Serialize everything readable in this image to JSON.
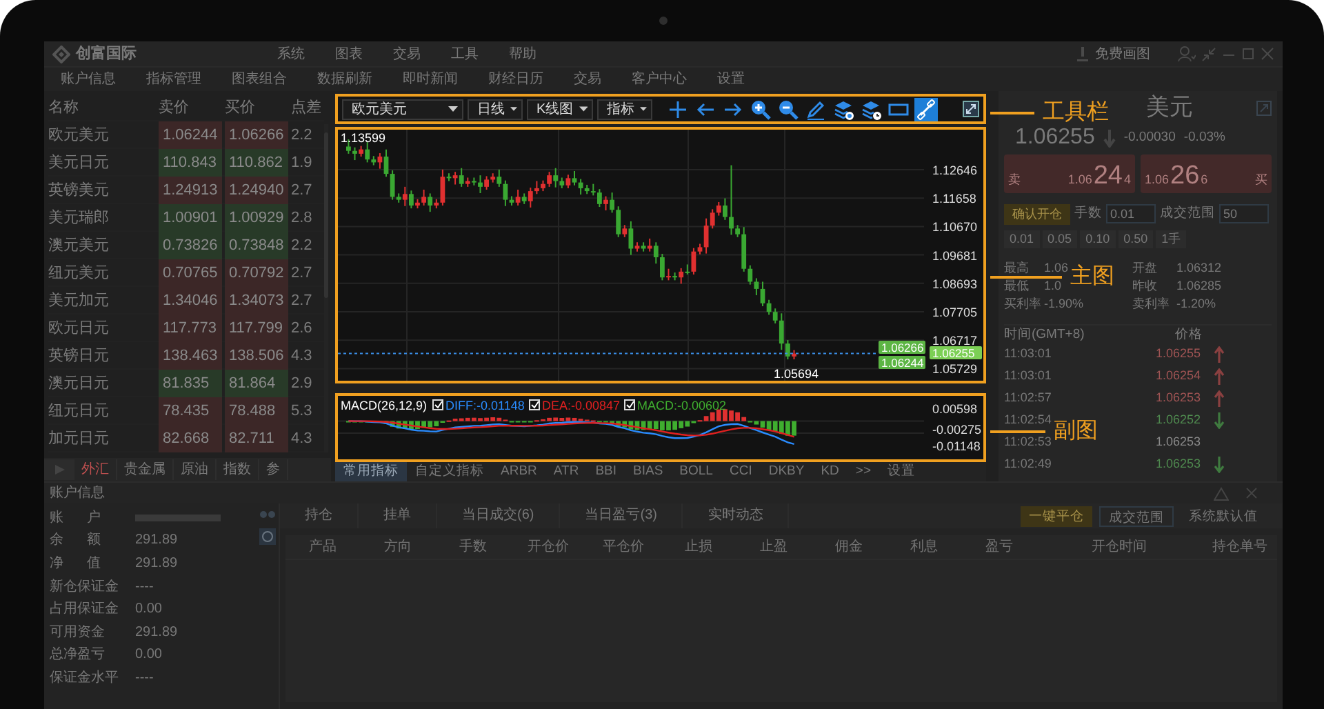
{
  "window": {
    "app_name": "创富国际",
    "menu": [
      "系统",
      "图表",
      "交易",
      "工具",
      "帮助"
    ],
    "free_drawing_link": "免费画图"
  },
  "toolbar": [
    "账户信息",
    "指标管理",
    "图表组合",
    "数据刷新",
    "即时新闻",
    "财经日历",
    "交易",
    "客户中心",
    "设置"
  ],
  "quotes": {
    "columns": [
      "名称",
      "卖价",
      "买价",
      "点差"
    ],
    "rows": [
      {
        "name": "欧元美元",
        "sell": "1.06244",
        "buy": "1.06266",
        "spread": "2.2",
        "color": "#3c2727"
      },
      {
        "name": "美元日元",
        "sell": "110.843",
        "buy": "110.862",
        "spread": "1.9",
        "color": "#283a28"
      },
      {
        "name": "英镑美元",
        "sell": "1.24913",
        "buy": "1.24940",
        "spread": "2.7",
        "color": "#3c2727"
      },
      {
        "name": "美元瑞郎",
        "sell": "1.00901",
        "buy": "1.00929",
        "spread": "2.8",
        "color": "#283a28"
      },
      {
        "name": "澳元美元",
        "sell": "0.73826",
        "buy": "0.73848",
        "spread": "2.2",
        "color": "#283a28"
      },
      {
        "name": "纽元美元",
        "sell": "0.70765",
        "buy": "0.70792",
        "spread": "2.7",
        "color": "#3c2727"
      },
      {
        "name": "美元加元",
        "sell": "1.34046",
        "buy": "1.34073",
        "spread": "2.7",
        "color": "#3c2727"
      },
      {
        "name": "欧元日元",
        "sell": "117.773",
        "buy": "117.799",
        "spread": "2.6",
        "color": "#3c2727"
      },
      {
        "name": "英镑日元",
        "sell": "138.463",
        "buy": "138.506",
        "spread": "4.3",
        "color": "#3c2727"
      },
      {
        "name": "澳元日元",
        "sell": "81.835",
        "buy": "81.864",
        "spread": "2.9",
        "color": "#283a28"
      },
      {
        "name": "纽元日元",
        "sell": "78.435",
        "buy": "78.488",
        "spread": "5.3",
        "color": "#3c2727"
      },
      {
        "name": "加元日元",
        "sell": "82.668",
        "buy": "82.711",
        "spread": "4.3",
        "color": "#3c2727"
      }
    ]
  },
  "market_tabs": [
    {
      "label": "外汇",
      "selected": true
    },
    {
      "label": "贵金属",
      "selected": false
    },
    {
      "label": "原油",
      "selected": false
    },
    {
      "label": "指数",
      "selected": false
    },
    {
      "label": "参",
      "selected": false
    }
  ],
  "chart_toolbar": {
    "selects": [
      "欧元美元",
      "日线",
      "K线图",
      "指标"
    ],
    "tools": [
      {
        "kind": "crosshair",
        "selected": false
      },
      {
        "kind": "arrow-left",
        "selected": false
      },
      {
        "kind": "arrow-right",
        "selected": false
      },
      {
        "kind": "zoom-in",
        "selected": false
      },
      {
        "kind": "zoom-out",
        "selected": false
      },
      {
        "kind": "pencil",
        "selected": false
      },
      {
        "kind": "stack-dollar",
        "selected": false
      },
      {
        "kind": "stack-clock",
        "selected": false
      },
      {
        "kind": "rectangle",
        "selected": false
      },
      {
        "kind": "link",
        "selected": true
      }
    ]
  },
  "main_chart": {
    "high_label": "1.13599",
    "low_label": "1.05694",
    "y_labels": [
      "1.12646",
      "1.11658",
      "1.10670",
      "1.09681",
      "1.08693",
      "1.07705",
      "1.06717",
      "1.05729"
    ],
    "price_tags": [
      {
        "text": "1.06266",
        "kind": "ask"
      },
      {
        "text": "1.06255",
        "kind": "last"
      },
      {
        "text": "1.06244",
        "kind": "bid"
      }
    ]
  },
  "sub_chart": {
    "title": "MACD(26,12,9)",
    "legend": [
      {
        "label": "DIFF:-0.01148",
        "checked": true,
        "color": "#2a8cff"
      },
      {
        "label": "DEA:-0.00847",
        "checked": true,
        "color": "#e02020"
      },
      {
        "label": "MACD:-0.00602",
        "checked": true,
        "color": "#3fae2f"
      }
    ],
    "y_labels": [
      "0.00598",
      "-0.00275",
      "-0.01148"
    ]
  },
  "indicator_tabs": [
    {
      "label": "常用指标",
      "selected": true
    },
    {
      "label": "自定义指标",
      "selected": false
    },
    {
      "label": "ARBR",
      "selected": false
    },
    {
      "label": "ATR",
      "selected": false
    },
    {
      "label": "BBI",
      "selected": false
    },
    {
      "label": "BIAS",
      "selected": false
    },
    {
      "label": "BOLL",
      "selected": false
    },
    {
      "label": "CCI",
      "selected": false
    },
    {
      "label": "DKBY",
      "selected": false
    },
    {
      "label": "KD",
      "selected": false
    },
    {
      "label": ">>",
      "selected": false
    },
    {
      "label": "设置",
      "selected": false
    }
  ],
  "quote_panel": {
    "symbol": "美元",
    "price": "1.06255",
    "change": "-0.00030",
    "change_pct": "-0.03%",
    "sell": {
      "label": "卖",
      "prefix": "1.06",
      "big": "24",
      "small": "4"
    },
    "buy": {
      "label": "买",
      "prefix": "1.06",
      "big": "26",
      "small": "6"
    },
    "confirm_button": "确认开仓",
    "lots_label": "手数",
    "lots_value": "0.01",
    "range_label": "成交范围",
    "range_value": "50",
    "quick_lots": [
      "0.01",
      "0.05",
      "0.10",
      "0.50",
      "1手"
    ],
    "stats": [
      {
        "label": "最高",
        "value": "1.06"
      },
      {
        "label": "开盘",
        "value": "1.06312"
      },
      {
        "label": "最低",
        "value": "1.0"
      },
      {
        "label": "昨收",
        "value": "1.06285"
      },
      {
        "label": "买利率",
        "value": "-1.90%"
      },
      {
        "label": "卖利率",
        "value": "-1.20%"
      }
    ],
    "ticks_header": [
      "时间(GMT+8)",
      "价格"
    ],
    "ticks": [
      {
        "time": "11:03:01",
        "price": "1.06255",
        "kind": "up"
      },
      {
        "time": "11:03:01",
        "price": "1.06254",
        "kind": "up"
      },
      {
        "time": "11:02:57",
        "price": "1.06253",
        "kind": "up"
      },
      {
        "time": "11:02:54",
        "price": "1.06252",
        "kind": "down"
      },
      {
        "time": "11:02:53",
        "price": "1.06253",
        "kind": "flat"
      },
      {
        "time": "11:02:49",
        "price": "1.06253",
        "kind": "down"
      }
    ]
  },
  "account": {
    "title": "账户信息",
    "rows": [
      {
        "label": "账 户",
        "kind": "masked"
      },
      {
        "label": "余 额",
        "kind": "value",
        "value": "291.89"
      },
      {
        "label": "净 值",
        "kind": "value",
        "value": "291.89"
      },
      {
        "label": "新仓保证金",
        "kind": "value",
        "value": "----"
      },
      {
        "label": "占用保证金",
        "kind": "value",
        "value": "0.00"
      },
      {
        "label": "可用资金",
        "kind": "value",
        "value": "291.89"
      },
      {
        "label": "总净盈亏",
        "kind": "value",
        "value": "0.00"
      },
      {
        "label": "保证金水平",
        "kind": "value",
        "value": "----"
      }
    ]
  },
  "orders": {
    "tabs": [
      {
        "label": "持仓",
        "selected": false
      },
      {
        "label": "挂单",
        "selected": false
      },
      {
        "label": "当日成交(6)",
        "selected": false
      },
      {
        "label": "当日盈亏(3)",
        "selected": false
      },
      {
        "label": "实时动态",
        "selected": false
      }
    ],
    "buttons": [
      {
        "label": "一键平仓",
        "kind": "primary"
      },
      {
        "label": "成交范围",
        "kind": "outline"
      },
      {
        "label": "系统默认值",
        "kind": "plain"
      }
    ],
    "columns": [
      "产品",
      "方向",
      "手数",
      "开仓价",
      "平仓价",
      "止损",
      "止盈",
      "佣金",
      "利息",
      "盈亏",
      "开仓时间",
      "持仓单号"
    ]
  },
  "annotations": [
    "工具栏",
    "主图",
    "副图"
  ]
}
